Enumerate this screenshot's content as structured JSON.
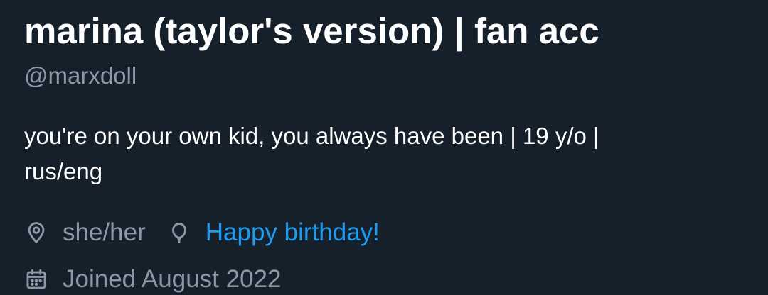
{
  "profile": {
    "display_name": "marina (taylor's version) | fan acc",
    "handle": "@marxdoll",
    "bio_line1": "you're on your own kid, you always have been | 19 y/o |",
    "bio_line2": "rus/eng",
    "location": "she/her",
    "birthday_link": "Happy birthday!",
    "joined": "Joined August 2022"
  },
  "icons": {
    "location": "location-pin-icon",
    "birthday": "balloon-icon",
    "joined": "calendar-icon"
  },
  "colors": {
    "background": "#15202b",
    "primary_text": "#ffffff",
    "secondary_text": "#8b98a5",
    "link": "#1d9bf0"
  }
}
